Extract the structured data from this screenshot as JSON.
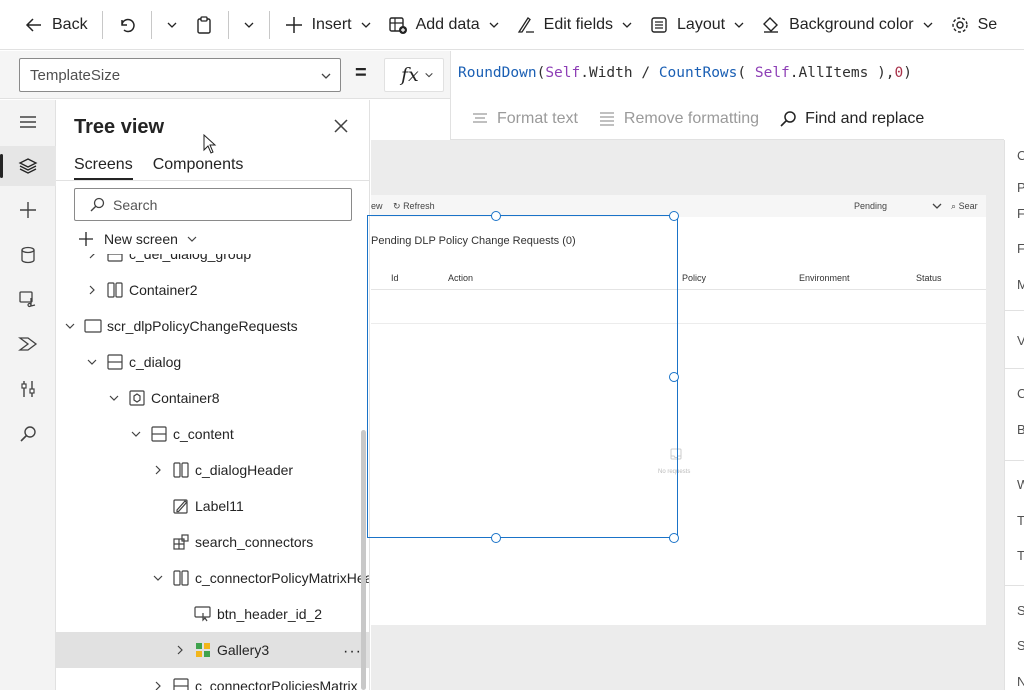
{
  "command_bar": {
    "back": "Back",
    "insert": "Insert",
    "add_data": "Add data",
    "edit_fields": "Edit fields",
    "layout": "Layout",
    "background_color": "Background color",
    "settings_partial": "Se"
  },
  "formula_bar": {
    "property": "TemplateSize",
    "equals": "=",
    "fx": "fx",
    "formula_tokens": [
      {
        "t": "RoundDown",
        "c": "fn"
      },
      {
        "t": "(",
        "c": "pn"
      },
      {
        "t": "Self",
        "c": "kw"
      },
      {
        "t": ".Width / ",
        "c": "pn"
      },
      {
        "t": "CountRows",
        "c": "fn"
      },
      {
        "t": "( ",
        "c": "pn"
      },
      {
        "t": "Self",
        "c": "kw"
      },
      {
        "t": ".AllItems ),",
        "c": "pn"
      },
      {
        "t": "0",
        "c": "num"
      },
      {
        "t": ")",
        "c": "pn"
      }
    ],
    "format_text": "Format text",
    "remove_formatting": "Remove formatting",
    "find_replace": "Find and replace"
  },
  "tree_view": {
    "title": "Tree view",
    "tabs": [
      "Screens",
      "Components"
    ],
    "search_placeholder": "Search",
    "new_screen": "New screen",
    "rows": [
      {
        "label": "c_del_dialog_group",
        "indent": 1,
        "arrow": "right",
        "icon": "vertical-container"
      },
      {
        "label": "Container2",
        "indent": 1,
        "arrow": "right",
        "icon": "horizontal-container"
      },
      {
        "label": "scr_dlpPolicyChangeRequests",
        "indent": 0,
        "arrow": "down",
        "icon": "screen"
      },
      {
        "label": "c_dialog",
        "indent": 1,
        "arrow": "down",
        "icon": "vertical-container"
      },
      {
        "label": "Container8",
        "indent": 2,
        "arrow": "down",
        "icon": "container"
      },
      {
        "label": "c_content",
        "indent": 3,
        "arrow": "down",
        "icon": "vertical-container"
      },
      {
        "label": "c_dialogHeader",
        "indent": 4,
        "arrow": "right",
        "icon": "horizontal-container"
      },
      {
        "label": "Label11",
        "indent": 4,
        "arrow": "none",
        "icon": "label"
      },
      {
        "label": "search_connectors",
        "indent": 4,
        "arrow": "none",
        "icon": "component"
      },
      {
        "label": "c_connectorPolicyMatrixHeader",
        "indent": 4,
        "arrow": "down",
        "icon": "horizontal-container"
      },
      {
        "label": "btn_header_id_2",
        "indent": 5,
        "arrow": "none",
        "icon": "button"
      },
      {
        "label": "Gallery3",
        "indent": 5,
        "arrow": "right",
        "icon": "gallery",
        "selected": true
      },
      {
        "label": "c_connectorPoliciesMatrix",
        "indent": 4,
        "arrow": "right",
        "icon": "vertical-container"
      }
    ]
  },
  "canvas": {
    "toolbar_view": "ew",
    "toolbar_refresh": "Refresh",
    "toolbar_filter": "Pending",
    "toolbar_search": "Sear",
    "list_title": "Pending DLP Policy Change Requests (0)",
    "columns": [
      "Id",
      "Action",
      "Policy",
      "Environment",
      "Status"
    ],
    "empty_message": "No requests"
  },
  "properties_panel": {
    "letters": [
      "C",
      "P",
      "F",
      "F",
      "M",
      "V",
      "C",
      "B",
      "W",
      "T",
      "T",
      "S",
      "S",
      "N"
    ]
  },
  "colors": {
    "accent": "#1a73c8",
    "selected_row": "#e1e1e1",
    "canvas_bg": "#ececec"
  }
}
